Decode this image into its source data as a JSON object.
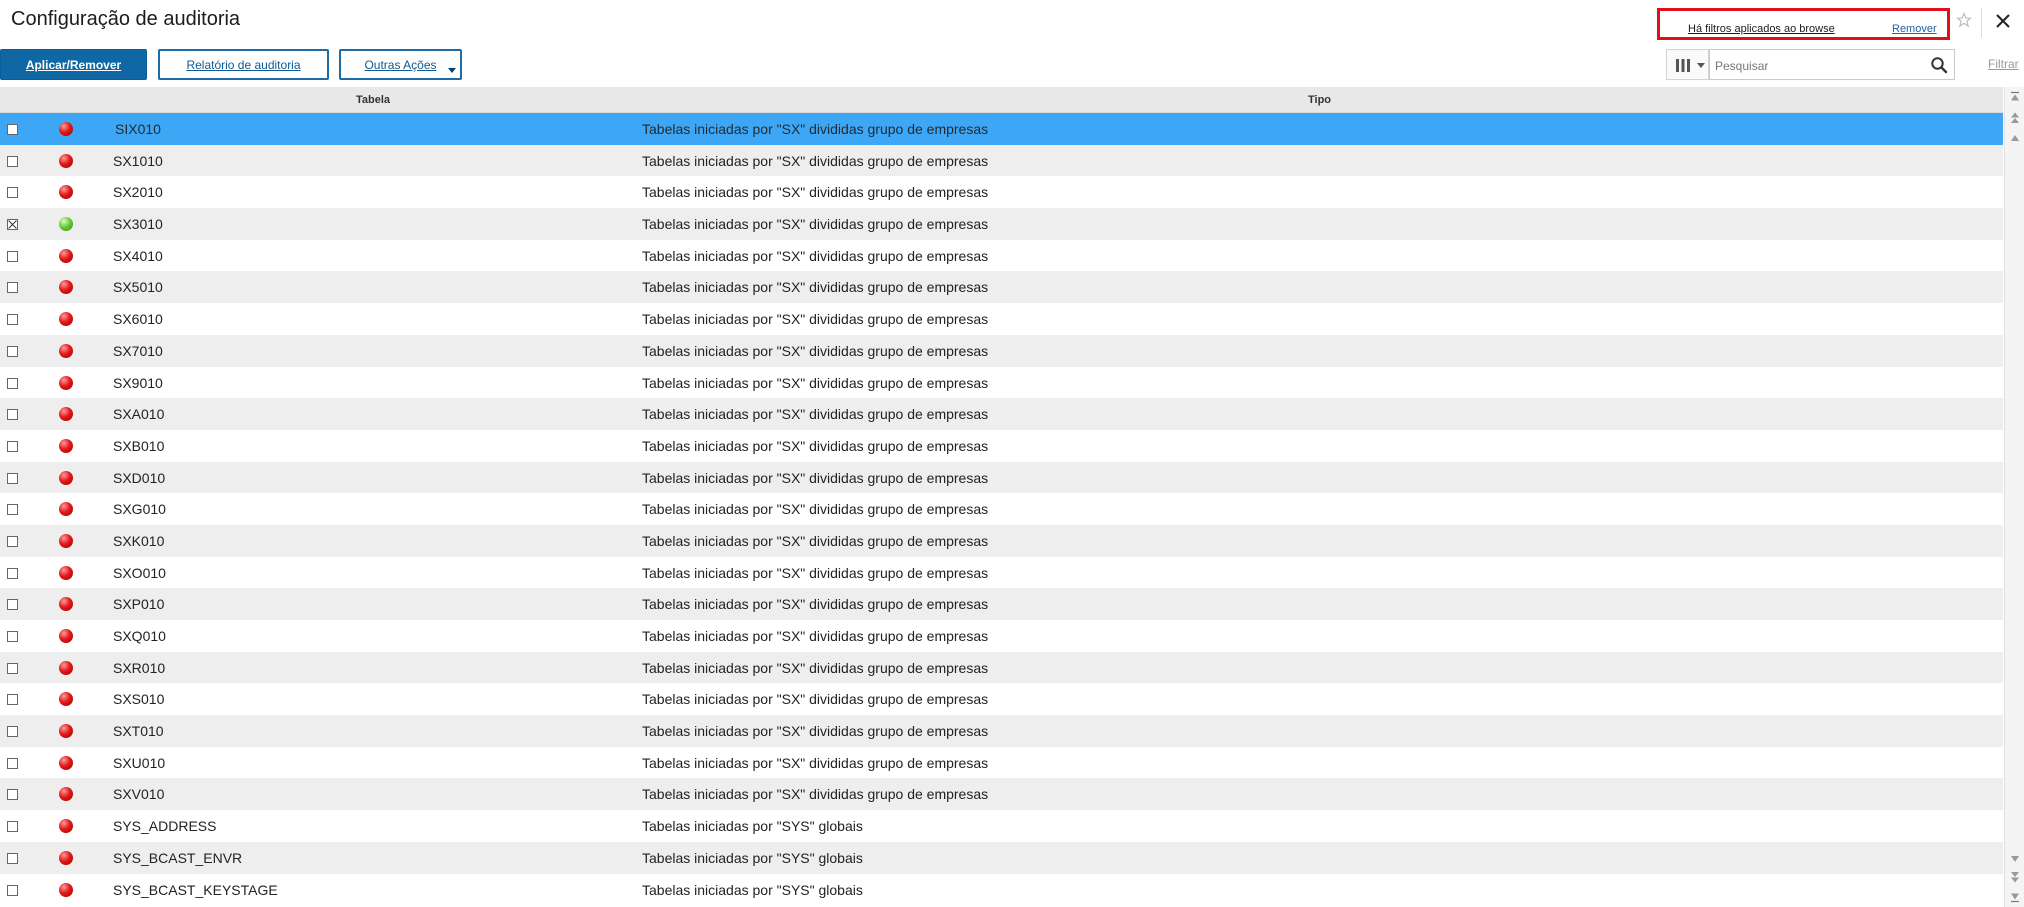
{
  "title": "Configuração de auditoria",
  "filter_notice": {
    "message": "Há filtros aplicados ao browse",
    "remove": "Remover"
  },
  "toolbar": {
    "apply_remove": "Aplicar/Remover",
    "report": "Relatório de auditoria",
    "more_actions": "Outras Ações"
  },
  "search": {
    "placeholder": "Pesquisar",
    "value": ""
  },
  "filter_link": "Filtrar",
  "grid": {
    "columns": [
      "Tabela",
      "Tipo"
    ],
    "rows": [
      {
        "tabela": "SIX010",
        "tipo": "Tabelas iniciadas por \"SX\" divididas grupo de empresas",
        "status": "red",
        "checked": false,
        "selected": true
      },
      {
        "tabela": "SX1010",
        "tipo": "Tabelas iniciadas por \"SX\" divididas grupo de empresas",
        "status": "red",
        "checked": false,
        "selected": false
      },
      {
        "tabela": "SX2010",
        "tipo": "Tabelas iniciadas por \"SX\" divididas grupo de empresas",
        "status": "red",
        "checked": false,
        "selected": false
      },
      {
        "tabela": "SX3010",
        "tipo": "Tabelas iniciadas por \"SX\" divididas grupo de empresas",
        "status": "green",
        "checked": true,
        "selected": false
      },
      {
        "tabela": "SX4010",
        "tipo": "Tabelas iniciadas por \"SX\" divididas grupo de empresas",
        "status": "red",
        "checked": false,
        "selected": false
      },
      {
        "tabela": "SX5010",
        "tipo": "Tabelas iniciadas por \"SX\" divididas grupo de empresas",
        "status": "red",
        "checked": false,
        "selected": false
      },
      {
        "tabela": "SX6010",
        "tipo": "Tabelas iniciadas por \"SX\" divididas grupo de empresas",
        "status": "red",
        "checked": false,
        "selected": false
      },
      {
        "tabela": "SX7010",
        "tipo": "Tabelas iniciadas por \"SX\" divididas grupo de empresas",
        "status": "red",
        "checked": false,
        "selected": false
      },
      {
        "tabela": "SX9010",
        "tipo": "Tabelas iniciadas por \"SX\" divididas grupo de empresas",
        "status": "red",
        "checked": false,
        "selected": false
      },
      {
        "tabela": "SXA010",
        "tipo": "Tabelas iniciadas por \"SX\" divididas grupo de empresas",
        "status": "red",
        "checked": false,
        "selected": false
      },
      {
        "tabela": "SXB010",
        "tipo": "Tabelas iniciadas por \"SX\" divididas grupo de empresas",
        "status": "red",
        "checked": false,
        "selected": false
      },
      {
        "tabela": "SXD010",
        "tipo": "Tabelas iniciadas por \"SX\" divididas grupo de empresas",
        "status": "red",
        "checked": false,
        "selected": false
      },
      {
        "tabela": "SXG010",
        "tipo": "Tabelas iniciadas por \"SX\" divididas grupo de empresas",
        "status": "red",
        "checked": false,
        "selected": false
      },
      {
        "tabela": "SXK010",
        "tipo": "Tabelas iniciadas por \"SX\" divididas grupo de empresas",
        "status": "red",
        "checked": false,
        "selected": false
      },
      {
        "tabela": "SXO010",
        "tipo": "Tabelas iniciadas por \"SX\" divididas grupo de empresas",
        "status": "red",
        "checked": false,
        "selected": false
      },
      {
        "tabela": "SXP010",
        "tipo": "Tabelas iniciadas por \"SX\" divididas grupo de empresas",
        "status": "red",
        "checked": false,
        "selected": false
      },
      {
        "tabela": "SXQ010",
        "tipo": "Tabelas iniciadas por \"SX\" divididas grupo de empresas",
        "status": "red",
        "checked": false,
        "selected": false
      },
      {
        "tabela": "SXR010",
        "tipo": "Tabelas iniciadas por \"SX\" divididas grupo de empresas",
        "status": "red",
        "checked": false,
        "selected": false
      },
      {
        "tabela": "SXS010",
        "tipo": "Tabelas iniciadas por \"SX\" divididas grupo de empresas",
        "status": "red",
        "checked": false,
        "selected": false
      },
      {
        "tabela": "SXT010",
        "tipo": "Tabelas iniciadas por \"SX\" divididas grupo de empresas",
        "status": "red",
        "checked": false,
        "selected": false
      },
      {
        "tabela": "SXU010",
        "tipo": "Tabelas iniciadas por \"SX\" divididas grupo de empresas",
        "status": "red",
        "checked": false,
        "selected": false
      },
      {
        "tabela": "SXV010",
        "tipo": "Tabelas iniciadas por \"SX\" divididas grupo de empresas",
        "status": "red",
        "checked": false,
        "selected": false
      },
      {
        "tabela": "SYS_ADDRESS",
        "tipo": "Tabelas iniciadas por \"SYS\" globais",
        "status": "red",
        "checked": false,
        "selected": false
      },
      {
        "tabela": "SYS_BCAST_ENVR",
        "tipo": "Tabelas iniciadas por \"SYS\" globais",
        "status": "red",
        "checked": false,
        "selected": false
      },
      {
        "tabela": "SYS_BCAST_KEYSTAGE",
        "tipo": "Tabelas iniciadas por \"SYS\" globais",
        "status": "red",
        "checked": false,
        "selected": false
      }
    ]
  },
  "colors": {
    "primary": "#0f67a3",
    "selected_row": "#3ea7f5",
    "alt_row": "#eeeeee",
    "notice_border": "#e0101b",
    "status_red": "#e21919",
    "status_green": "#6cc93c"
  },
  "icons": [
    "star-icon",
    "close-icon",
    "columns-icon",
    "search-icon",
    "scroll-up-icon",
    "scroll-down-icon"
  ]
}
